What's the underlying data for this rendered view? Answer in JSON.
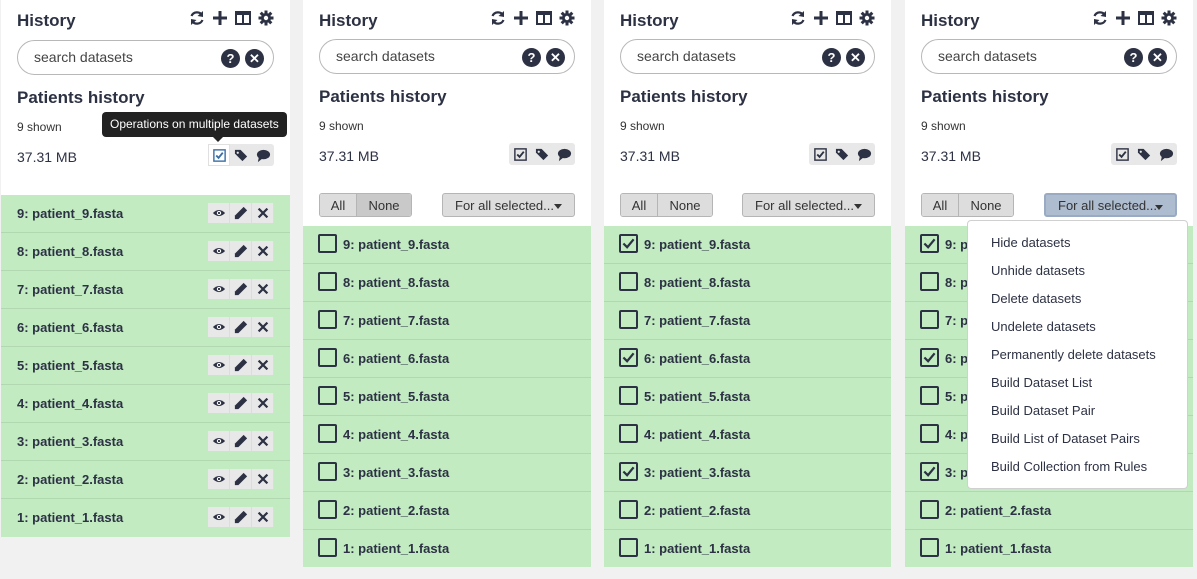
{
  "panels": [
    {
      "title": "History",
      "search_placeholder": "search datasets",
      "history_name": "Patients history",
      "shown": "9 shown",
      "size": "37.31 MB",
      "tooltip": "Operations on multiple datasets",
      "datasets": [
        "9: patient_9.fasta",
        "8: patient_8.fasta",
        "7: patient_7.fasta",
        "6: patient_6.fasta",
        "5: patient_5.fasta",
        "4: patient_4.fasta",
        "3: patient_3.fasta",
        "2: patient_2.fasta",
        "1: patient_1.fasta"
      ]
    },
    {
      "title": "History",
      "search_placeholder": "search datasets",
      "history_name": "Patients history",
      "shown": "9 shown",
      "size": "37.31 MB",
      "select_all_label": "All",
      "select_none_label": "None",
      "for_all_label": "For all selected...",
      "datasets": [
        "9: patient_9.fasta",
        "8: patient_8.fasta",
        "7: patient_7.fasta",
        "6: patient_6.fasta",
        "5: patient_5.fasta",
        "4: patient_4.fasta",
        "3: patient_3.fasta",
        "2: patient_2.fasta",
        "1: patient_1.fasta"
      ],
      "checked": [
        false,
        false,
        false,
        false,
        false,
        false,
        false,
        false,
        false
      ]
    },
    {
      "title": "History",
      "search_placeholder": "search datasets",
      "history_name": "Patients history",
      "shown": "9 shown",
      "size": "37.31 MB",
      "select_all_label": "All",
      "select_none_label": "None",
      "for_all_label": "For all selected...",
      "datasets": [
        "9: patient_9.fasta",
        "8: patient_8.fasta",
        "7: patient_7.fasta",
        "6: patient_6.fasta",
        "5: patient_5.fasta",
        "4: patient_4.fasta",
        "3: patient_3.fasta",
        "2: patient_2.fasta",
        "1: patient_1.fasta"
      ],
      "checked": [
        true,
        false,
        false,
        true,
        false,
        false,
        true,
        false,
        false
      ]
    },
    {
      "title": "History",
      "search_placeholder": "search datasets",
      "history_name": "Patients history",
      "shown": "9 shown",
      "size": "37.31 MB",
      "select_all_label": "All",
      "select_none_label": "None",
      "for_all_label": "For all selected...",
      "datasets": [
        "9: p",
        "8: p",
        "7: p",
        "6: p",
        "5: p",
        "4: p",
        "3: p",
        "2: patient_2.fasta",
        "1: patient_1.fasta"
      ],
      "checked": [
        true,
        false,
        false,
        true,
        false,
        false,
        true,
        false,
        false
      ]
    }
  ],
  "dropdown_menu": [
    "Hide datasets",
    "Unhide datasets",
    "Delete datasets",
    "Undelete datasets",
    "Permanently delete datasets",
    "Build Dataset List",
    "Build Dataset Pair",
    "Build List of Dataset Pairs",
    "Build Collection from Rules"
  ],
  "colors": {
    "dataset_ok": "#c2ebc2",
    "brand_dark": "#2c3143"
  }
}
